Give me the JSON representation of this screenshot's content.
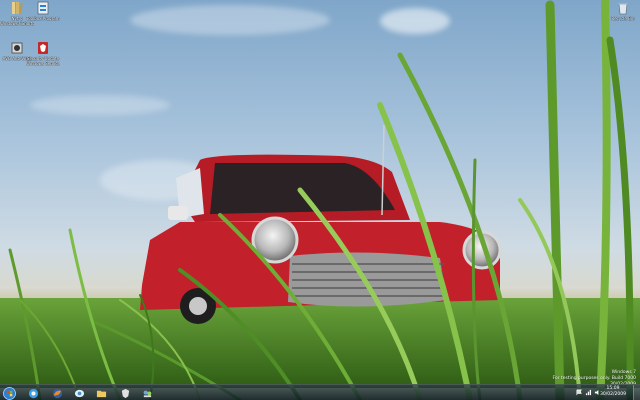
{
  "desktop_icons": [
    {
      "name": "Nytro Windows 7 Shortcut",
      "label_line1": "Nytro",
      "label_line2": "Windows7.Shortcut",
      "icon": "library-icon"
    },
    {
      "name": "Toolbox Program",
      "label_line1": "Toolbox Program",
      "label_line2": "",
      "icon": "program-icon"
    },
    {
      "name": "AVG Anti-Virus",
      "label_line1": "AVG Anti-Virus",
      "label_line2": "",
      "icon": "app-icon"
    },
    {
      "name": "Security Update",
      "label_line1": "Security Update",
      "label_line2": "Windows Service",
      "icon": "shield-icon"
    },
    {
      "name": "Recycle Bin",
      "label_line1": "Recycle Bin",
      "label_line2": "",
      "icon": "recycle-bin-icon"
    }
  ],
  "watermark": {
    "line1": "Windows 7",
    "line2": "For testing purposes only. Build 7000"
  },
  "taskbar": {
    "pinned": [
      {
        "name": "internet-explorer",
        "icon": "ie-icon"
      },
      {
        "name": "firefox",
        "icon": "firefox-icon"
      },
      {
        "name": "windows-live",
        "icon": "live-icon"
      },
      {
        "name": "explorer",
        "icon": "folder-icon"
      },
      {
        "name": "security-app",
        "icon": "shield-icon"
      },
      {
        "name": "network",
        "icon": "network-icon"
      }
    ],
    "clock_time": "15:09",
    "clock_date": "30/02/2009"
  },
  "colors": {
    "accent": "#2f7fd0",
    "car_red": "#c2202a",
    "grass": "#4c8a25"
  }
}
